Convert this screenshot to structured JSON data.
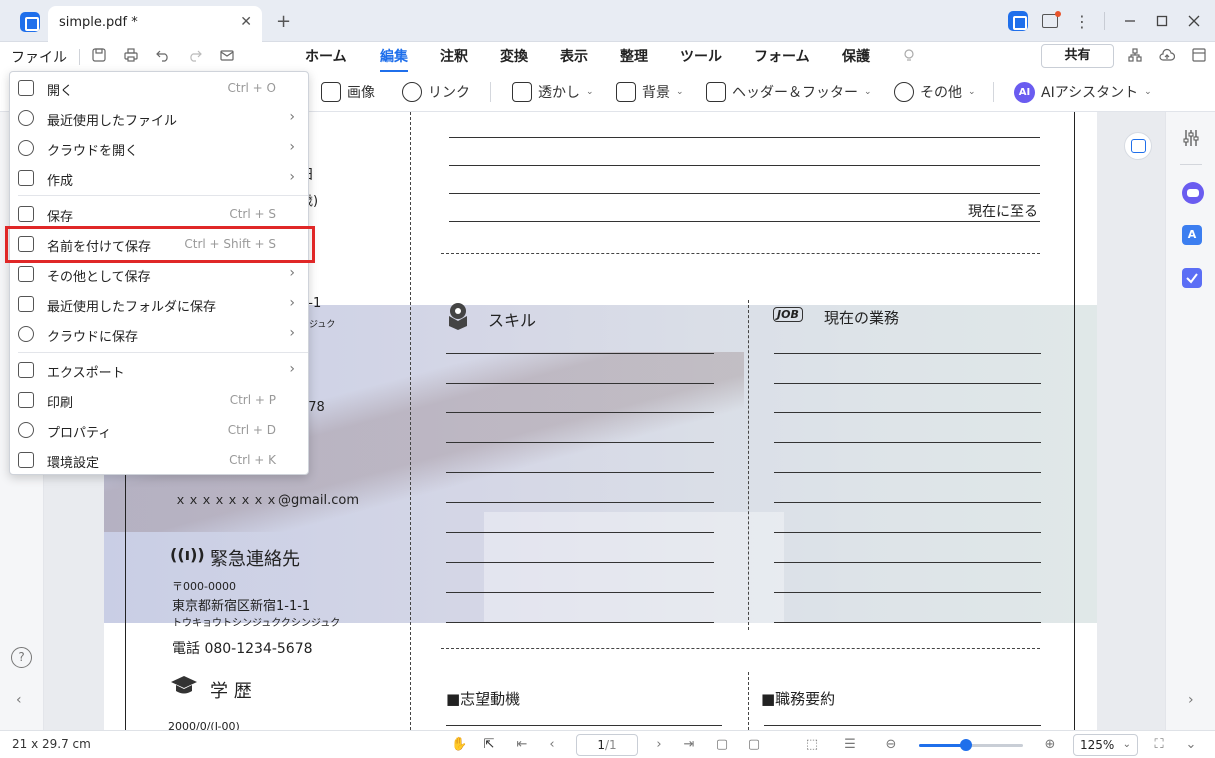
{
  "window": {
    "tab_title": "simple.pdf *",
    "close_glyph": "✕",
    "new_tab_glyph": "+"
  },
  "menubar": {
    "file_label": "ファイル",
    "tabs": [
      "ホーム",
      "編集",
      "注釈",
      "変換",
      "表示",
      "整理",
      "ツール",
      "フォーム",
      "保護"
    ],
    "active_tab": "編集",
    "share_label": "共有"
  },
  "ribbon": {
    "image": "画像",
    "link": "リンク",
    "watermark": "透かし",
    "background": "背景",
    "header_footer": "ヘッダー＆フッター",
    "more": "その他",
    "ai_badge": "AI",
    "ai_assistant": "AIアシスタント"
  },
  "file_menu": {
    "items": [
      {
        "label": "開く",
        "shortcut": "Ctrl + O",
        "submenu": false
      },
      {
        "label": "最近使用したファイル",
        "shortcut": "",
        "submenu": true
      },
      {
        "label": "クラウドを開く",
        "shortcut": "",
        "submenu": true
      },
      {
        "label": "作成",
        "shortcut": "",
        "submenu": true
      },
      {
        "label": "保存",
        "shortcut": "Ctrl + S",
        "submenu": false
      },
      {
        "label": "名前を付けて保存",
        "shortcut": "Ctrl + Shift + S",
        "submenu": false
      },
      {
        "label": "その他として保存",
        "shortcut": "",
        "submenu": true
      },
      {
        "label": "最近使用したフォルダに保存",
        "shortcut": "",
        "submenu": true
      },
      {
        "label": "クラウドに保存",
        "shortcut": "",
        "submenu": true
      },
      {
        "label": "エクスポート",
        "shortcut": "",
        "submenu": true
      },
      {
        "label": "印刷",
        "shortcut": "Ctrl + P",
        "submenu": false
      },
      {
        "label": "プロパティ",
        "shortcut": "Ctrl + D",
        "submenu": false
      },
      {
        "label": "環境設定",
        "shortcut": "Ctrl + K",
        "submenu": false
      }
    ],
    "highlighted_item": "名前を付けて保存"
  },
  "document": {
    "until_now": "現在に至る",
    "skills_heading": "スキル",
    "job_badge": "JOB",
    "current_work_heading": "現在の業務",
    "email": "ｘｘｘｘｘｘｘｘ@gmail.com",
    "emergency_heading": "緊急連絡先",
    "postal": "〒000-0000",
    "address": "東京都新宿区新宿1-1-1",
    "address_kana": "トウキョウトシンジュククシンジュク",
    "phone": "電話 080-1234-5678",
    "education_heading": "学 歴",
    "motivation_heading": "■志望動機",
    "job_summary_heading": "■職務要約",
    "partial_a": "日",
    "partial_b": "歳)",
    "partial_c": "1-1",
    "partial_d": "ンジュク",
    "partial_e": "678",
    "partial_f": "2000/0/(J-00)"
  },
  "statusbar": {
    "page_size": "21 x 29.7 cm",
    "current_page": "1",
    "total_pages": "/1",
    "zoom": "125%",
    "zoom_fraction": 0.45
  },
  "colors": {
    "accent": "#1f6feb",
    "highlight_border": "#e02727"
  }
}
